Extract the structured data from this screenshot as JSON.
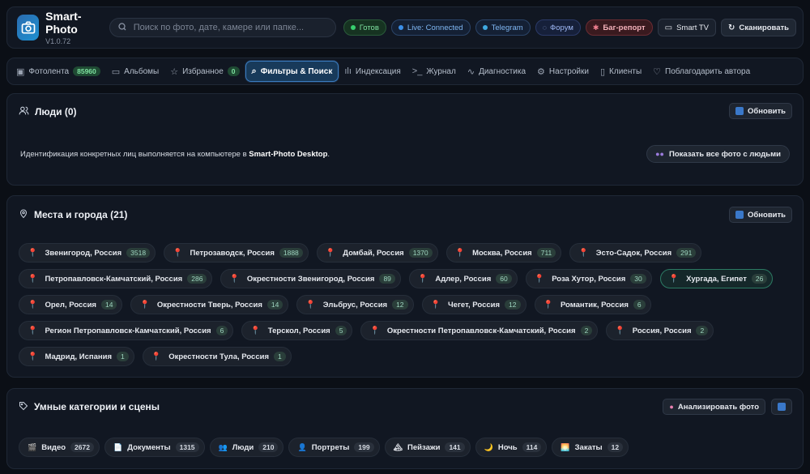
{
  "app": {
    "name": "Smart-Photo",
    "version": "V1.0.72"
  },
  "search": {
    "placeholder": "Поиск по фото, дате, камере или папке..."
  },
  "status": {
    "ready": "Готов",
    "live": "Live: Connected",
    "telegram": "Telegram",
    "forum": "Форум",
    "bug": "Баг-репорт",
    "smart_tv": "Smart TV",
    "scan": "Сканировать"
  },
  "tabs": [
    {
      "label": "Фотолента",
      "badge": "85960",
      "icon": "image-icon"
    },
    {
      "label": "Альбомы",
      "icon": "folder-icon"
    },
    {
      "label": "Избранное",
      "badge": "0",
      "icon": "star-icon"
    },
    {
      "label": "Фильтры & Поиск",
      "icon": "search-icon",
      "active": true
    },
    {
      "label": "Индексация",
      "icon": "bar-chart-icon"
    },
    {
      "label": "Журнал",
      "icon": "terminal-icon"
    },
    {
      "label": "Диагностика",
      "icon": "pulse-icon"
    },
    {
      "label": "Настройки",
      "icon": "gear-icon"
    },
    {
      "label": "Клиенты",
      "icon": "phone-icon"
    },
    {
      "label": "Поблагодарить автора",
      "icon": "heart-icon"
    }
  ],
  "people": {
    "title": "Люди (0)",
    "refresh": "Обновить",
    "text_before": "Идентификация конкретных лиц выполняется на компьютере в ",
    "text_bold": "Smart-Photo Desktop",
    "text_after": ".",
    "show_all": "Показать все фото с людьми"
  },
  "places": {
    "title": "Места и города (21)",
    "refresh": "Обновить",
    "items": [
      {
        "name": "Звенигород, Россия",
        "count": "3518"
      },
      {
        "name": "Петрозаводск, Россия",
        "count": "1888"
      },
      {
        "name": "Домбай, Россия",
        "count": "1370"
      },
      {
        "name": "Москва, Россия",
        "count": "711"
      },
      {
        "name": "Эсто-Садок, Россия",
        "count": "291"
      },
      {
        "name": "Петропавловск-Камчатский, Россия",
        "count": "286"
      },
      {
        "name": "Окрестности Звенигород, Россия",
        "count": "89"
      },
      {
        "name": "Адлер, Россия",
        "count": "60"
      },
      {
        "name": "Роза Хутор, Россия",
        "count": "30"
      },
      {
        "name": "Хургада, Египет",
        "count": "26",
        "selected": true
      },
      {
        "name": "Орел, Россия",
        "count": "14"
      },
      {
        "name": "Окрестности Тверь, Россия",
        "count": "14"
      },
      {
        "name": "Эльбрус, Россия",
        "count": "12"
      },
      {
        "name": "Чегет, Россия",
        "count": "12"
      },
      {
        "name": "Романтик, Россия",
        "count": "6"
      },
      {
        "name": "Регион Петропавловск-Камчатский, Россия",
        "count": "6"
      },
      {
        "name": "Терскол, Россия",
        "count": "5"
      },
      {
        "name": "Окрестности Петропавловск-Камчатский, Россия",
        "count": "2"
      },
      {
        "name": "Россия, Россия",
        "count": "2"
      },
      {
        "name": "Мадрид, Испания",
        "count": "1"
      },
      {
        "name": "Окрестности Тула, Россия",
        "count": "1"
      }
    ]
  },
  "smart": {
    "title": "Умные категории и сцены",
    "analyze": "Анализировать фото",
    "items": [
      {
        "name": "Видео",
        "count": "2672",
        "emoji": "🎬"
      },
      {
        "name": "Документы",
        "count": "1315",
        "emoji": "📄"
      },
      {
        "name": "Люди",
        "count": "210",
        "emoji": "👥"
      },
      {
        "name": "Портреты",
        "count": "199",
        "emoji": "👤"
      },
      {
        "name": "Пейзажи",
        "count": "141",
        "emoji": "🏔"
      },
      {
        "name": "Ночь",
        "count": "114",
        "emoji": "🌙"
      },
      {
        "name": "Закаты",
        "count": "12",
        "emoji": "🌅"
      }
    ]
  }
}
